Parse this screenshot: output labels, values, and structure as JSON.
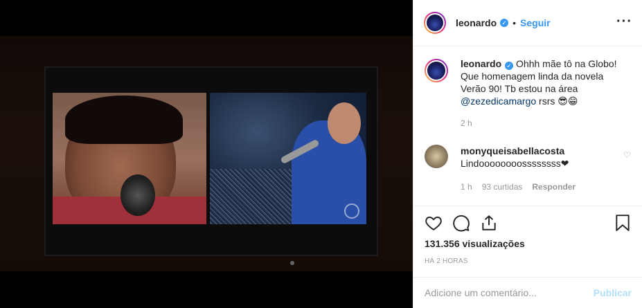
{
  "post": {
    "owner": "leonardo",
    "follow_label": "Seguir",
    "separator": "•",
    "more_label": "···"
  },
  "caption": {
    "username": "leonardo",
    "text_before": "Ohhh mãe tô na Globo! Que homenagem linda da novela Verão 90! Tb estou na área ",
    "mention": "@zezedicamargo",
    "text_after": " rsrs 😎😁",
    "time": "2 h"
  },
  "comments": [
    {
      "username": "monyqueisabellacosta",
      "text": "Lindoooooooossssssss❤",
      "time": "1 h",
      "likes": "93 curtidas",
      "reply_label": "Responder"
    }
  ],
  "stats": {
    "views": "131.356 visualizações",
    "posted_ago": "HÁ 2 HORAS"
  },
  "composer": {
    "placeholder": "Adicione um comentário...",
    "publish_label": "Publicar"
  },
  "icons": {
    "like": "heart-icon",
    "comment": "comment-icon",
    "share": "share-icon",
    "save": "bookmark-icon",
    "verified": "verified-badge-icon"
  },
  "colors": {
    "link_blue": "#3897f0",
    "mention": "#003569",
    "muted": "#999999",
    "publish_disabled": "#b2dffc"
  }
}
